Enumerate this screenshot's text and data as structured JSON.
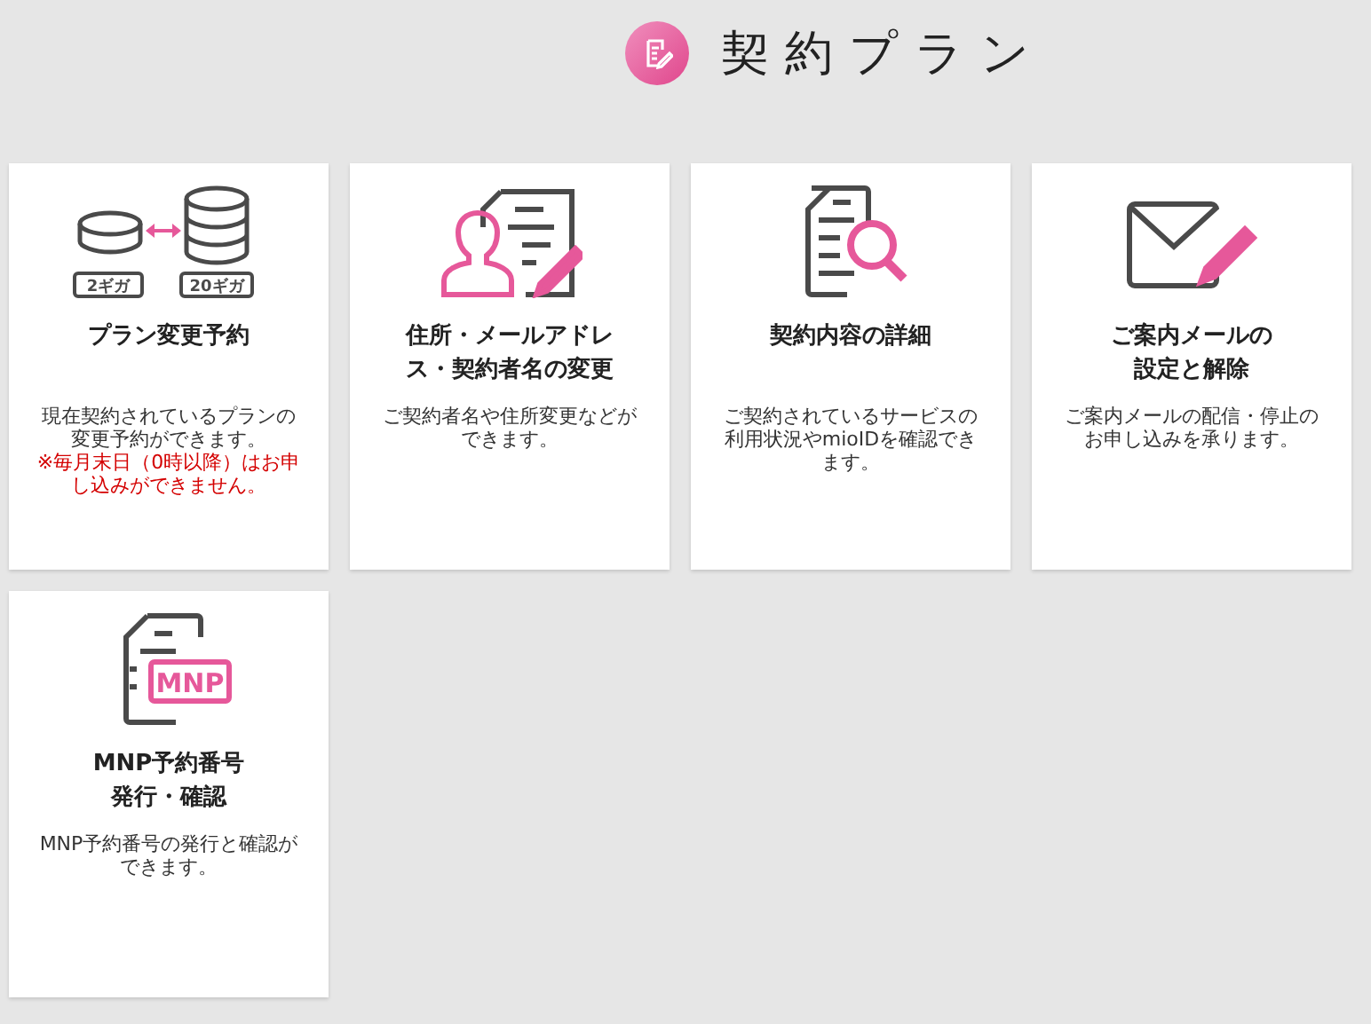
{
  "header": {
    "title": "契約プラン"
  },
  "cards": [
    {
      "icon": {
        "kind": "storage",
        "labels": [
          "2ギガ",
          "20ギガ"
        ]
      },
      "title": [
        "プラン変更予約"
      ],
      "description": "現在契約されているプランの変更予約ができます。",
      "note": "※毎月末日（0時以降）はお申し込みができません。"
    },
    {
      "icon": {
        "kind": "person-doc"
      },
      "title": [
        "住所・メールアドレ",
        "ス・契約者名の変更"
      ],
      "description": "ご契約者名や住所変更などができます。"
    },
    {
      "icon": {
        "kind": "search-doc"
      },
      "title": [
        "契約内容の詳細"
      ],
      "description": "ご契約されているサービスの利用状況やmioIDを確認できます。"
    },
    {
      "icon": {
        "kind": "mail"
      },
      "title": [
        "ご案内メールの",
        "設定と解除"
      ],
      "description": "ご案内メールの配信・停止のお申し込みを承ります。"
    },
    {
      "icon": {
        "kind": "mnp",
        "labels": [
          "MNP"
        ]
      },
      "title": [
        "MNP予約番号",
        "発行・確認"
      ],
      "description": "MNP予約番号の発行と確認ができます。"
    }
  ]
}
